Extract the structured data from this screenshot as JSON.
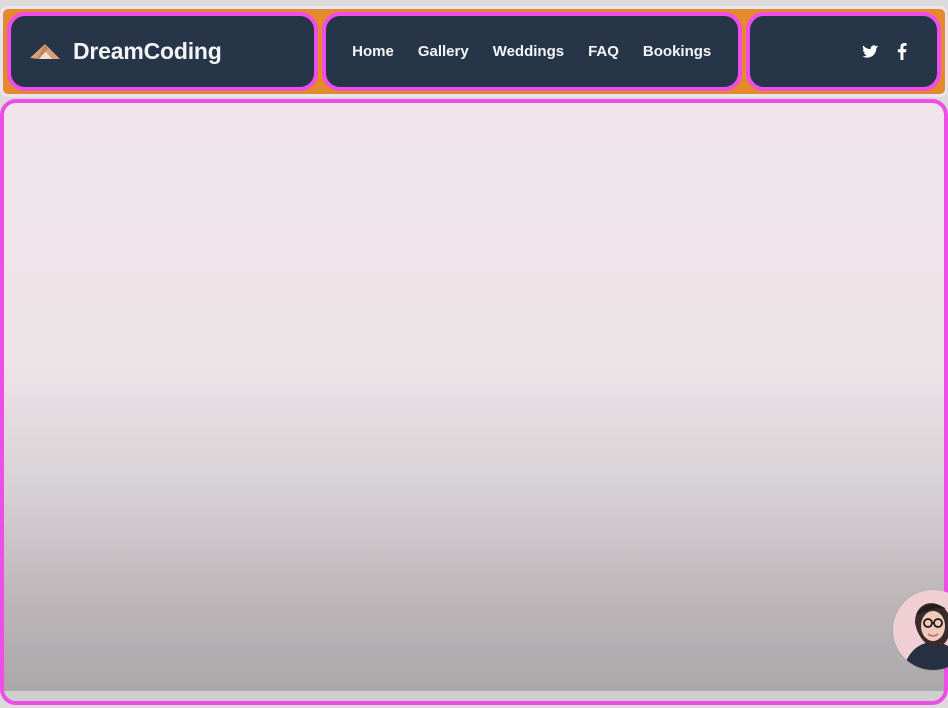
{
  "header": {
    "brand": {
      "name": "DreamCoding",
      "icon": "paper-plane-logo-icon"
    },
    "nav": {
      "items": [
        {
          "label": "Home"
        },
        {
          "label": "Gallery"
        },
        {
          "label": "Weddings"
        },
        {
          "label": "FAQ"
        },
        {
          "label": "Bookings"
        }
      ]
    },
    "social": {
      "items": [
        {
          "icon": "twitter-icon"
        },
        {
          "icon": "facebook-icon"
        }
      ]
    }
  },
  "colors": {
    "header_background": "#e58a2c",
    "panel_background": "#273549",
    "outline": "#ef4de8",
    "text": "#f4f5f7",
    "logo_accent": "#d7a27b"
  },
  "overlay": {
    "icon": "presenter-avatar"
  }
}
